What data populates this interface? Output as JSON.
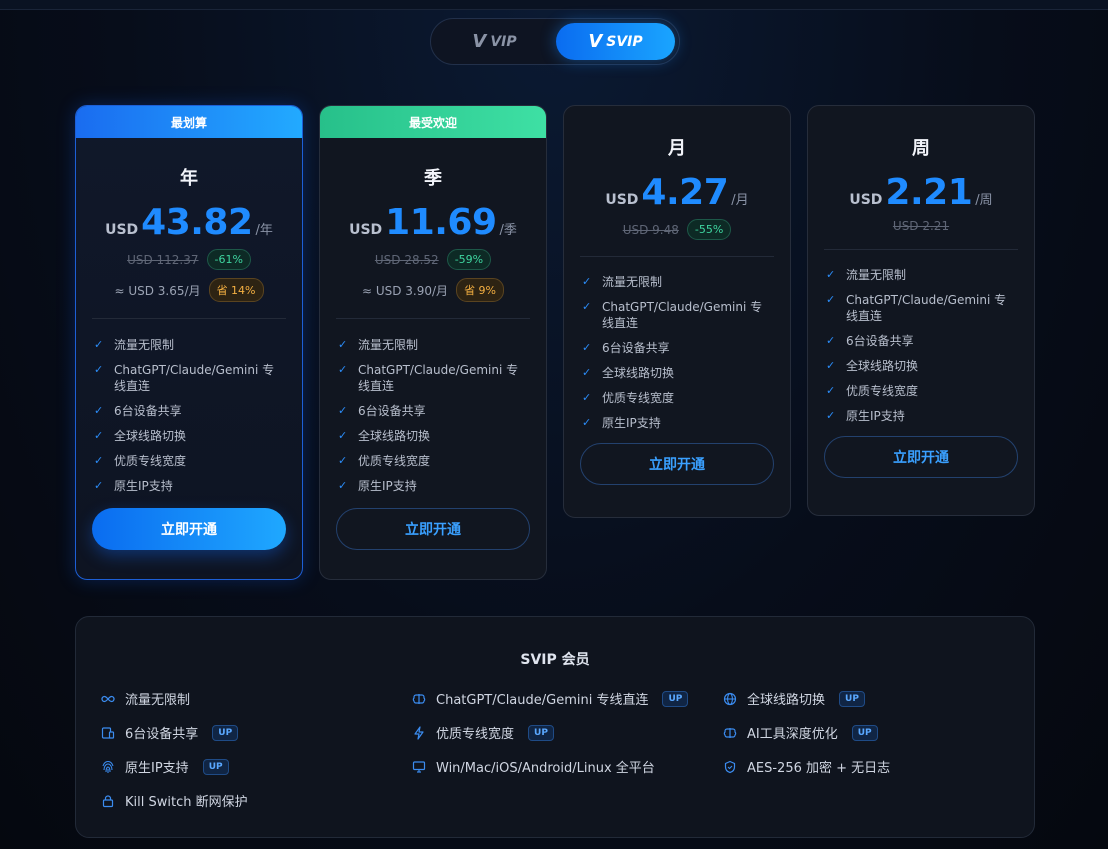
{
  "toggle": {
    "vip_label": "VIP",
    "svip_label": "SVIP",
    "selected": "SVIP"
  },
  "plans": [
    {
      "ribbon": "最划算",
      "title": "年",
      "currency": "USD",
      "price": "43.82",
      "per": "/年",
      "original": "USD 112.37",
      "discount": "-61%",
      "monthly": "≈ USD 3.65/月",
      "save": "省 14%",
      "features": [
        "流量无限制",
        "ChatGPT/Claude/Gemini 专线直连",
        "6台设备共享",
        "全球线路切换",
        "优质专线宽度",
        "原生IP支持"
      ],
      "cta": "立即开通"
    },
    {
      "ribbon": "最受欢迎",
      "title": "季",
      "currency": "USD",
      "price": "11.69",
      "per": "/季",
      "original": "USD 28.52",
      "discount": "-59%",
      "monthly": "≈ USD 3.90/月",
      "save": "省 9%",
      "features": [
        "流量无限制",
        "ChatGPT/Claude/Gemini 专线直连",
        "6台设备共享",
        "全球线路切换",
        "优质专线宽度",
        "原生IP支持"
      ],
      "cta": "立即开通"
    },
    {
      "title": "月",
      "currency": "USD",
      "price": "4.27",
      "per": "/月",
      "original": "USD 9.48",
      "discount": "-55%",
      "features": [
        "流量无限制",
        "ChatGPT/Claude/Gemini 专线直连",
        "6台设备共享",
        "全球线路切换",
        "优质专线宽度",
        "原生IP支持"
      ],
      "cta": "立即开通"
    },
    {
      "title": "周",
      "currency": "USD",
      "price": "2.21",
      "per": "/周",
      "original": "USD 2.21",
      "features": [
        "流量无限制",
        "ChatGPT/Claude/Gemini 专线直连",
        "6台设备共享",
        "全球线路切换",
        "优质专线宽度",
        "原生IP支持"
      ],
      "cta": "立即开通"
    }
  ],
  "summary": {
    "title": "SVIP 会员",
    "up_label": "UP",
    "items": [
      {
        "icon": "infinity-icon",
        "text": "流量无限制"
      },
      {
        "icon": "brain-icon",
        "text": "ChatGPT/Claude/Gemini 专线直连"
      },
      {
        "icon": "globe-icon",
        "text": "全球线路切换"
      },
      {
        "icon": "devices-icon",
        "text": "6台设备共享"
      },
      {
        "icon": "lightning-icon",
        "text": "优质专线宽度"
      },
      {
        "icon": "brain-icon",
        "text": "AI工具深度优化"
      },
      {
        "icon": "fingerprint-icon",
        "text": "原生IP支持"
      },
      {
        "icon": "monitor-icon",
        "text": "Win/Mac/iOS/Android/Linux 全平台"
      },
      {
        "icon": "shield-icon",
        "text": "AES-256 加密 + 无日志"
      },
      {
        "icon": "lock-icon",
        "text": "Kill Switch 断网保护"
      }
    ]
  }
}
